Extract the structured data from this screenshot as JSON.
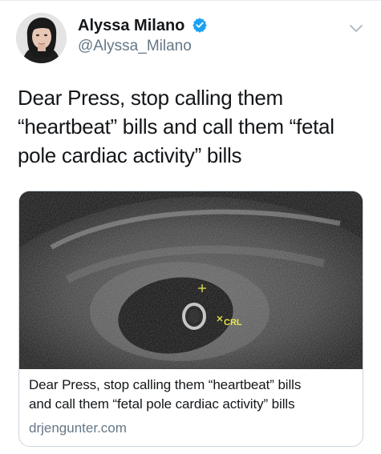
{
  "author": {
    "display_name": "Alyssa Milano",
    "handle": "@Alyssa_Milano",
    "verified": true,
    "avatar_icon": "profile-photo"
  },
  "tweet": {
    "text_lines": [
      "Dear Press, stop calling them",
      "“heartbeat” bills and call them “fetal",
      "pole cardiac activity” bills"
    ]
  },
  "card": {
    "image_label": "CRL",
    "title_lines": [
      "Dear Press, stop calling them “heartbeat” bills",
      "and call them “fetal pole cardiac activity” bills"
    ],
    "domain": "drjengunter.com"
  },
  "icons": {
    "verified": "verified-badge-icon",
    "menu": "chevron-down-icon"
  },
  "colors": {
    "verified_blue": "#1da1f2",
    "secondary_text": "#657786",
    "border": "#ccd6dd",
    "measure_marker": "#e8e84a"
  }
}
